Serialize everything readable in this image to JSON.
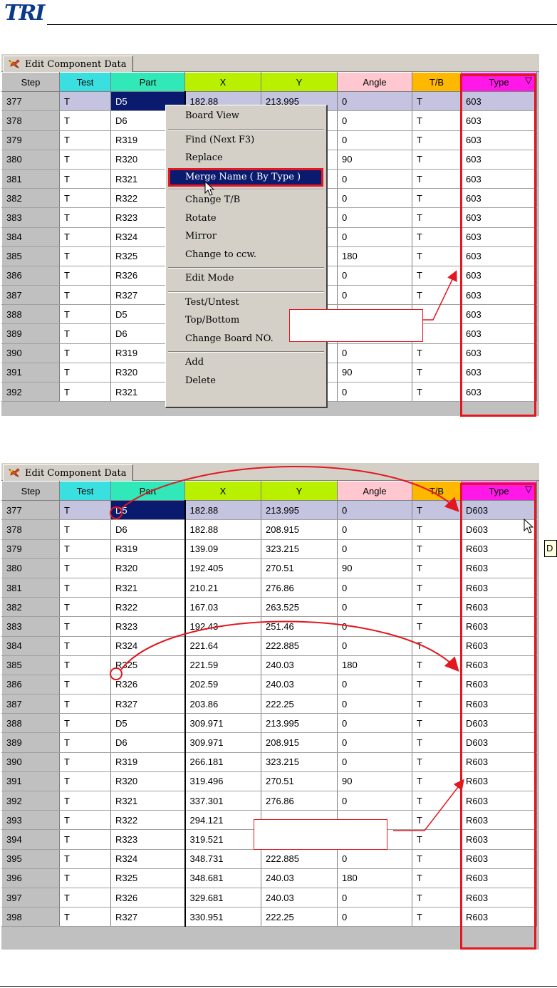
{
  "header": {
    "logo": "TRI"
  },
  "colors": {
    "accent_red": "#e3171f",
    "selection_blue": "#0a1a6e",
    "row_highlight": "#c4c4e0"
  },
  "panel1": {
    "tab_label": "Edit Component Data",
    "columns": [
      "Step",
      "Test",
      "Part",
      "X",
      "Y",
      "Angle",
      "T/B",
      "Type"
    ],
    "sort_indicator": "▽",
    "rows": [
      [
        "377",
        "T",
        "D5",
        "182.88",
        "213.995",
        "0",
        "T",
        "603"
      ],
      [
        "378",
        "T",
        "D6",
        "",
        "",
        "0",
        "T",
        "603"
      ],
      [
        "379",
        "T",
        "R319",
        "",
        "",
        "0",
        "T",
        "603"
      ],
      [
        "380",
        "T",
        "R320",
        "",
        "",
        "90",
        "T",
        "603"
      ],
      [
        "381",
        "T",
        "R321",
        "",
        "",
        "0",
        "T",
        "603"
      ],
      [
        "382",
        "T",
        "R322",
        "",
        "",
        "0",
        "T",
        "603"
      ],
      [
        "383",
        "T",
        "R323",
        "",
        "",
        "0",
        "T",
        "603"
      ],
      [
        "384",
        "T",
        "R324",
        "",
        "",
        "0",
        "T",
        "603"
      ],
      [
        "385",
        "T",
        "R325",
        "",
        "",
        "180",
        "T",
        "603"
      ],
      [
        "386",
        "T",
        "R326",
        "",
        "",
        "0",
        "T",
        "603"
      ],
      [
        "387",
        "T",
        "R327",
        "",
        "",
        "0",
        "T",
        "603"
      ],
      [
        "388",
        "T",
        "D5",
        "",
        "",
        "",
        "",
        "603"
      ],
      [
        "389",
        "T",
        "D6",
        "",
        "",
        "",
        "",
        "603"
      ],
      [
        "390",
        "T",
        "R319",
        "",
        "",
        "0",
        "T",
        "603"
      ],
      [
        "391",
        "T",
        "R320",
        "",
        "",
        "90",
        "T",
        "603"
      ],
      [
        "392",
        "T",
        "R321",
        "",
        "",
        "0",
        "T",
        "603"
      ]
    ]
  },
  "context_menu": {
    "items": [
      {
        "label": "Board View"
      },
      {
        "sep": true
      },
      {
        "label": "Find (Next F3)"
      },
      {
        "label": "Replace"
      },
      {
        "label": "Merge Name ( By Type )",
        "highlighted": true
      },
      {
        "sep": true
      },
      {
        "label": "Change T/B"
      },
      {
        "label": "Rotate"
      },
      {
        "label": "Mirror"
      },
      {
        "label": "Change to ccw."
      },
      {
        "sep": true
      },
      {
        "label": "Edit Mode"
      },
      {
        "sep": true
      },
      {
        "label": "Test/Untest"
      },
      {
        "label": "Top/Bottom"
      },
      {
        "label": "Change Board NO."
      },
      {
        "sep": true
      },
      {
        "label": "Add"
      },
      {
        "label": "Delete"
      }
    ]
  },
  "panel2": {
    "tab_label": "Edit Component Data",
    "columns": [
      "Step",
      "Test",
      "Part",
      "X",
      "Y",
      "Angle",
      "T/B",
      "Type"
    ],
    "sort_indicator": "▽",
    "tooltip": "D",
    "rows": [
      [
        "377",
        "T",
        "D5",
        "182.88",
        "213.995",
        "0",
        "T",
        "D603"
      ],
      [
        "378",
        "T",
        "D6",
        "182.88",
        "208.915",
        "0",
        "T",
        "D603"
      ],
      [
        "379",
        "T",
        "R319",
        "139.09",
        "323.215",
        "0",
        "T",
        "R603"
      ],
      [
        "380",
        "T",
        "R320",
        "192.405",
        "270.51",
        "90",
        "T",
        "R603"
      ],
      [
        "381",
        "T",
        "R321",
        "210.21",
        "276.86",
        "0",
        "T",
        "R603"
      ],
      [
        "382",
        "T",
        "R322",
        "167.03",
        "263.525",
        "0",
        "T",
        "R603"
      ],
      [
        "383",
        "T",
        "R323",
        "192.43",
        "251.46",
        "0",
        "T",
        "R603"
      ],
      [
        "384",
        "T",
        "R324",
        "221.64",
        "222.885",
        "0",
        "T",
        "R603"
      ],
      [
        "385",
        "T",
        "R325",
        "221.59",
        "240.03",
        "180",
        "T",
        "R603"
      ],
      [
        "386",
        "T",
        "R326",
        "202.59",
        "240.03",
        "0",
        "T",
        "R603"
      ],
      [
        "387",
        "T",
        "R327",
        "203.86",
        "222.25",
        "0",
        "T",
        "R603"
      ],
      [
        "388",
        "T",
        "D5",
        "309.971",
        "213.995",
        "0",
        "T",
        "D603"
      ],
      [
        "389",
        "T",
        "D6",
        "309.971",
        "208.915",
        "0",
        "T",
        "D603"
      ],
      [
        "390",
        "T",
        "R319",
        "266.181",
        "323.215",
        "0",
        "T",
        "R603"
      ],
      [
        "391",
        "T",
        "R320",
        "319.496",
        "270.51",
        "90",
        "T",
        "R603"
      ],
      [
        "392",
        "T",
        "R321",
        "337.301",
        "276.86",
        "0",
        "T",
        "R603"
      ],
      [
        "393",
        "T",
        "R322",
        "294.121",
        "",
        "",
        "T",
        "R603"
      ],
      [
        "394",
        "T",
        "R323",
        "319.521",
        "251.46",
        "0",
        "T",
        "R603"
      ],
      [
        "395",
        "T",
        "R324",
        "348.731",
        "222.885",
        "0",
        "T",
        "R603"
      ],
      [
        "396",
        "T",
        "R325",
        "348.681",
        "240.03",
        "180",
        "T",
        "R603"
      ],
      [
        "397",
        "T",
        "R326",
        "329.681",
        "240.03",
        "0",
        "T",
        "R603"
      ],
      [
        "398",
        "T",
        "R327",
        "330.951",
        "222.25",
        "0",
        "T",
        "R603"
      ]
    ]
  }
}
